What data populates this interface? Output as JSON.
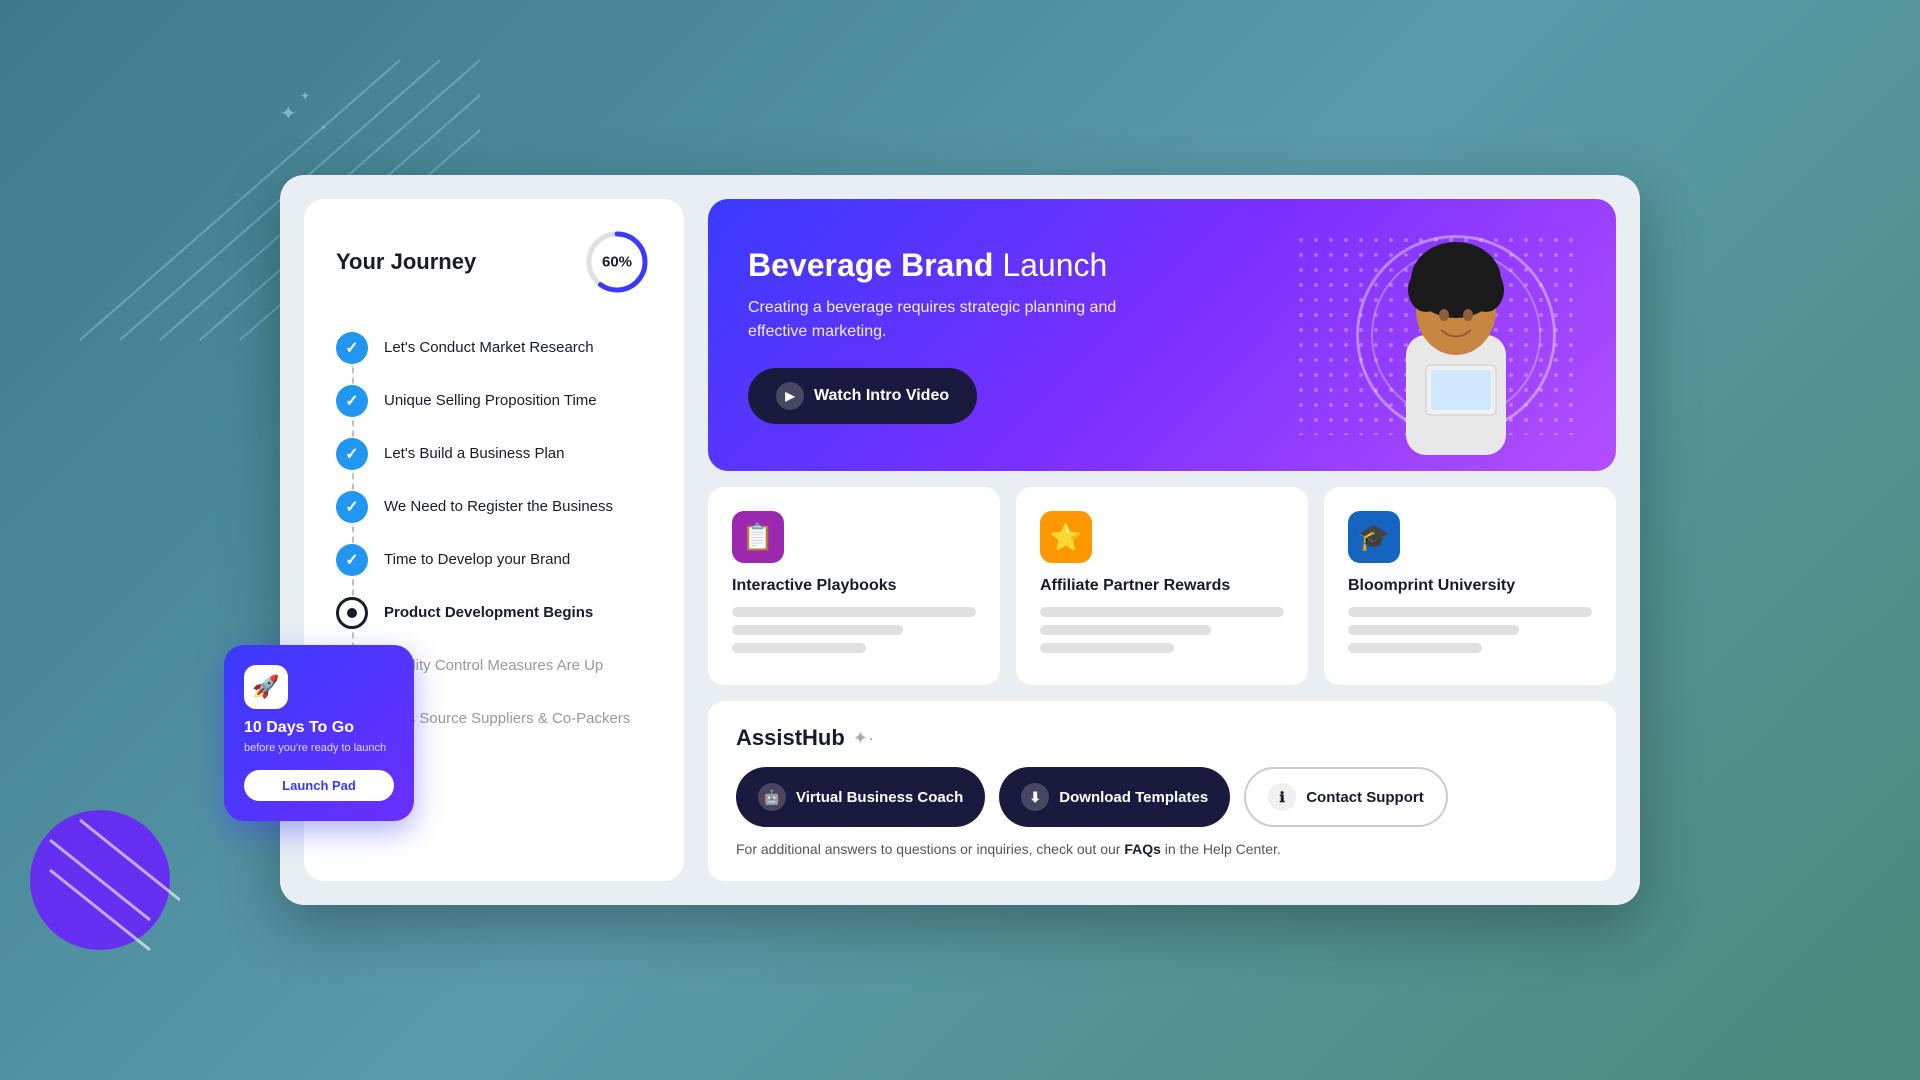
{
  "page": {
    "bg_color": "#4a8a9a"
  },
  "left_panel": {
    "title": "Your Journey",
    "progress": {
      "percent": 60,
      "label": "60%"
    },
    "items": [
      {
        "label": "Let's Conduct Market Research",
        "status": "completed"
      },
      {
        "label": "Unique Selling Proposition Time",
        "status": "completed"
      },
      {
        "label": "Let's Build a Business Plan",
        "status": "completed"
      },
      {
        "label": "We Need to Register the Business",
        "status": "completed"
      },
      {
        "label": "Time to Develop your Brand",
        "status": "completed"
      },
      {
        "label": "Product Development Begins",
        "status": "current"
      },
      {
        "label": "Quality Control Measures Are Up",
        "status": "pending"
      },
      {
        "label": "Let's Source Suppliers & Co-Packers",
        "status": "pending"
      }
    ]
  },
  "hero": {
    "title_bold": "Beverage Brand",
    "title_rest": " Launch",
    "description": "Creating a beverage requires strategic planning and effective marketing.",
    "watch_btn_label": "Watch Intro Video"
  },
  "feature_cards": [
    {
      "id": "interactive-playbooks",
      "title": "Interactive Playbooks",
      "icon": "📋",
      "icon_style": "purple"
    },
    {
      "id": "affiliate-partner-rewards",
      "title": "Affiliate Partner Rewards",
      "icon": "⭐",
      "icon_style": "amber"
    },
    {
      "id": "bloomprint-university",
      "title": "Bloomprint University",
      "icon": "🎓",
      "icon_style": "blue"
    }
  ],
  "assist_hub": {
    "title_bold": "Assist",
    "title_rest": "Hub",
    "sparkle": "✦·",
    "buttons": [
      {
        "id": "virtual-coach",
        "label": "Virtual Business Coach",
        "icon": "🤖",
        "style": "primary"
      },
      {
        "id": "download-templates",
        "label": "Download Templates",
        "icon": "⬇",
        "style": "primary"
      },
      {
        "id": "contact-support",
        "label": "Contact Support",
        "icon": "ℹ",
        "style": "outline"
      }
    ],
    "footer_text": "For additional answers to questions or inquiries, check out our ",
    "footer_link": "FAQs",
    "footer_rest": " in the Help Center."
  },
  "launch_pad": {
    "icon": "🚀",
    "title": "10 Days To Go",
    "subtitle": "before you're ready to launch",
    "btn_label": "Launch Pad"
  }
}
